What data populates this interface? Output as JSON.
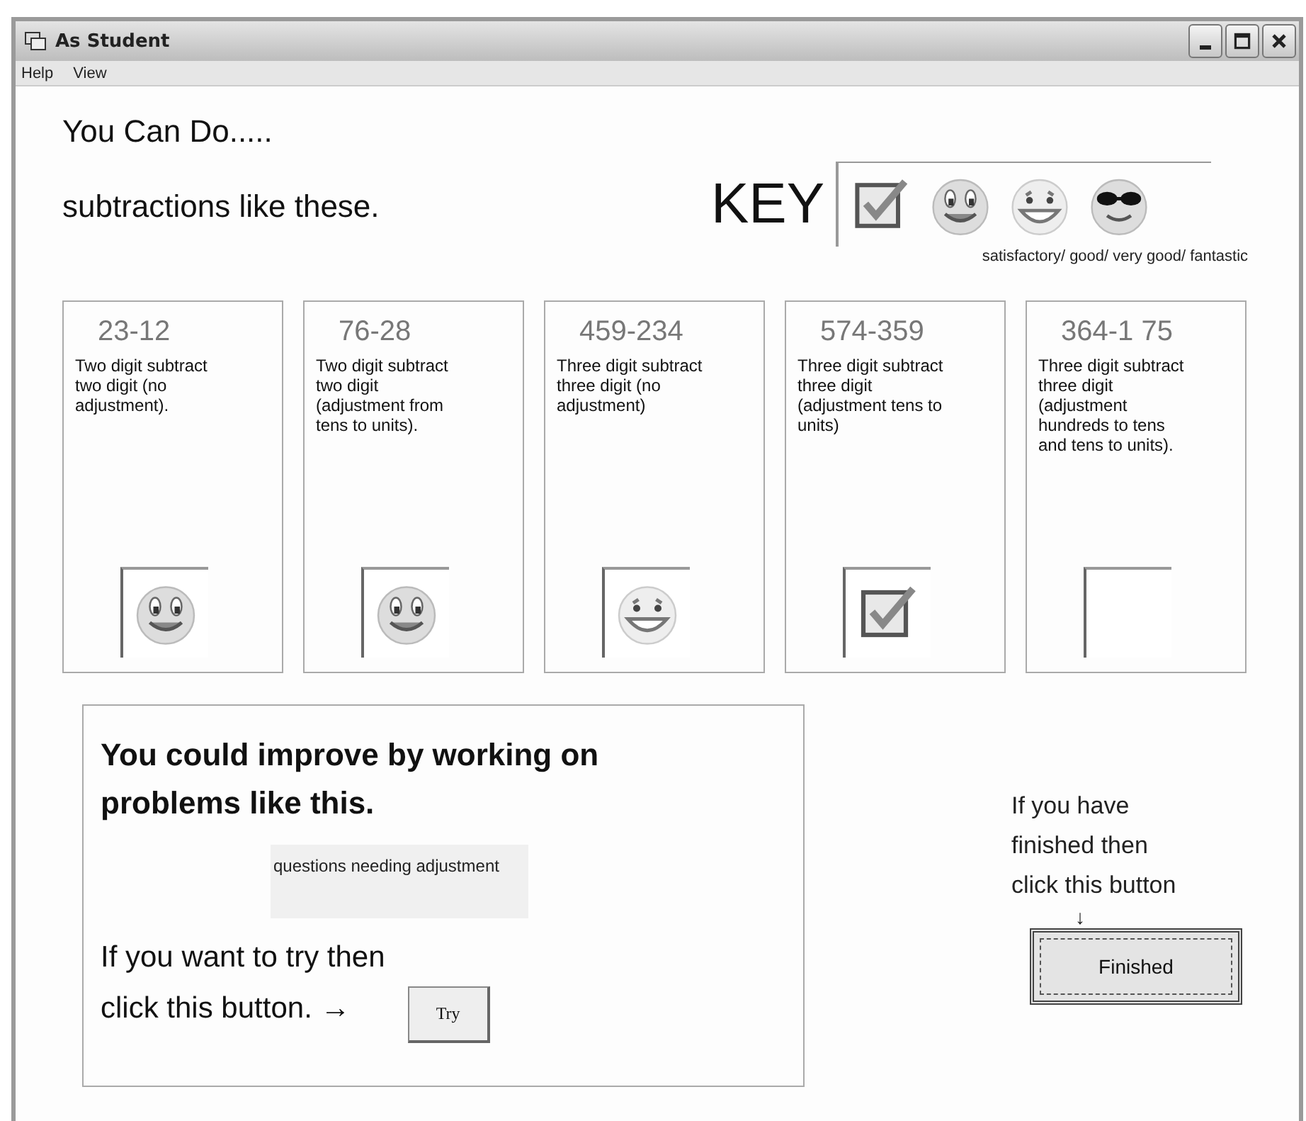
{
  "window": {
    "title": "As Student"
  },
  "menu": [
    {
      "label": "Help"
    },
    {
      "label": "View"
    }
  ],
  "heading": {
    "line_1": "You Can Do.....",
    "line_2": "subtractions like these."
  },
  "key": {
    "label": "KEY",
    "icons": [
      {
        "kind": "satisfactory"
      },
      {
        "kind": "good"
      },
      {
        "kind": "very_good"
      },
      {
        "kind": "fantastic"
      }
    ],
    "caption": "satisfactory/ good/ very good/ fantastic"
  },
  "cards": [
    {
      "sum": "23-12",
      "description": "Two digit subtract two digit (no adjustment).",
      "rating": {
        "kind": "good"
      }
    },
    {
      "sum": "76-28",
      "description": "Two digit subtract two digit (adjustment from tens to units).",
      "rating": {
        "kind": "good"
      }
    },
    {
      "sum": "459-234",
      "description": "Three digit subtract three digit (no adjustment)",
      "rating": {
        "kind": "very_good"
      }
    },
    {
      "sum": "574-359",
      "description": "Three digit subtract three digit (adjustment tens to units)",
      "rating": {
        "kind": "satisfactory"
      }
    },
    {
      "sum": "364-1 75",
      "description": "Three digit subtract three digit (adjustment hundreds to tens and tens to units)."
    }
  ],
  "improve": {
    "title": "You could improve by working on problems like this.",
    "topic": "questions needing adjustment",
    "try_text_1": "If you want to try then",
    "try_text_2": "click this button. →",
    "try_button": "Try"
  },
  "finish": {
    "text": "If you have finished then click this button",
    "arrow": "↓",
    "button": "Finished"
  }
}
